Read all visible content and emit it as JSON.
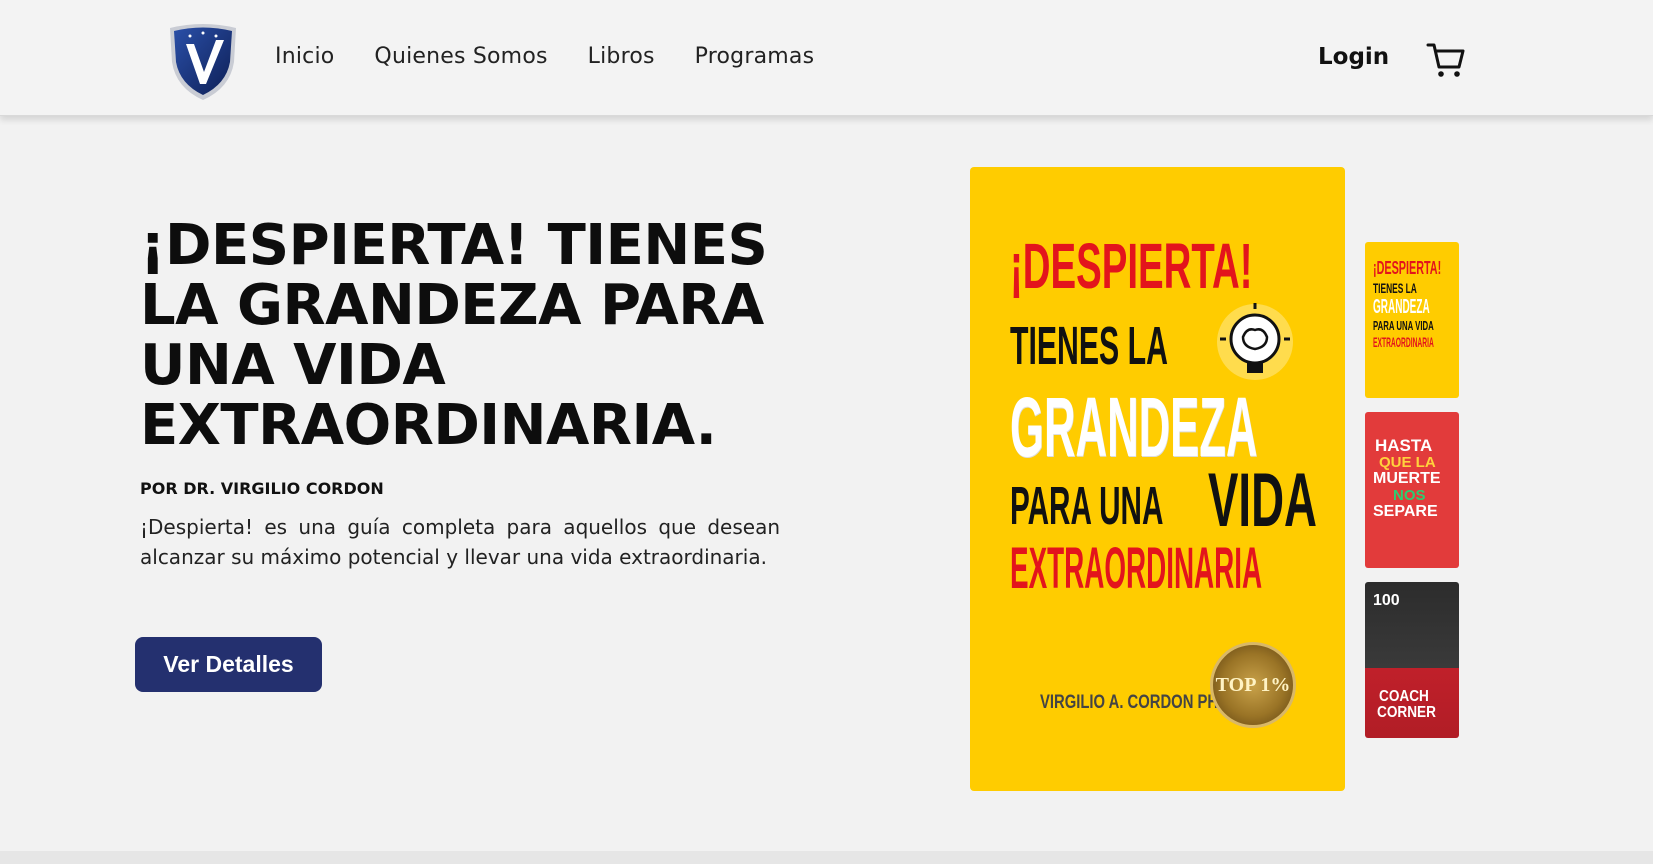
{
  "nav": {
    "links": [
      "Inicio",
      "Quienes Somos",
      "Libros",
      "Programas"
    ],
    "login": "Login",
    "logo_icon": "shield-v-logo",
    "cart_icon": "cart-icon"
  },
  "hero": {
    "title": "¡DESPIERTA! TIENES LA GRANDEZA PARA UNA VIDA EXTRAORDINARIA.",
    "author": "POR DR. VIRGILIO CORDON",
    "description": "¡Despierta! es una guía completa para aquellos que desean alcanzar su máximo potencial y llevar una vida extraordinaria.",
    "cta": "Ver Detalles"
  },
  "cover": {
    "lines": [
      "¡DESPIERTA!",
      "TIENES LA",
      "GRANDEZA",
      "PARA UNA",
      "VIDA",
      "EXTRAORDINARIA"
    ],
    "author": "VIRGILIO A. CORDON PH. D.",
    "seal": "TOP 1%"
  },
  "thumbnails": [
    {
      "lines": [
        "¡DESPIERTA!",
        "TIENES LA",
        "GRANDEZA",
        "PARA UNA VIDA",
        "EXTRAORDINARIA"
      ]
    },
    {
      "lines": [
        "HASTA",
        "QUE LA",
        "MUERTE",
        "NOS",
        "SEPARE"
      ]
    },
    {
      "lines": [
        "100",
        "COACH",
        "CORNER"
      ]
    }
  ],
  "colors": {
    "accent": "#24306f",
    "cover_yellow": "#ffcc00",
    "cover_red": "#e3141c"
  }
}
